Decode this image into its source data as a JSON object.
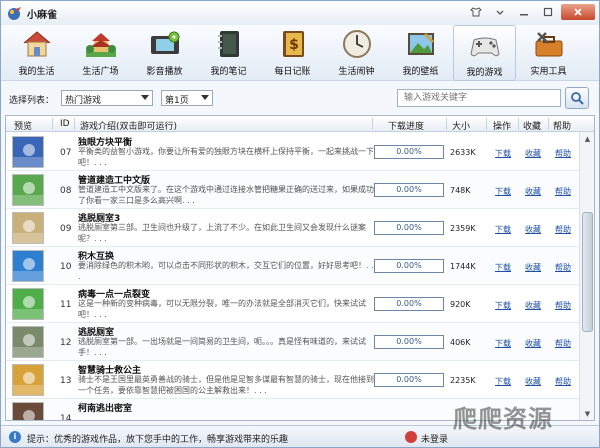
{
  "app": {
    "title": "小麻雀"
  },
  "toolbar": {
    "items": [
      {
        "label": "我的生活",
        "icon": "house-icon"
      },
      {
        "label": "生活广场",
        "icon": "pagoda-icon"
      },
      {
        "label": "影音播放",
        "icon": "film-icon"
      },
      {
        "label": "我的笔记",
        "icon": "notebook-icon"
      },
      {
        "label": "每日记账",
        "icon": "ledger-icon"
      },
      {
        "label": "生活闹钟",
        "icon": "clock-icon"
      },
      {
        "label": "我的壁纸",
        "icon": "wallpaper-icon"
      },
      {
        "label": "我的游戏",
        "icon": "gamepad-icon",
        "active": true
      },
      {
        "label": "实用工具",
        "icon": "toolbox-icon"
      }
    ]
  },
  "filter": {
    "label": "选择列表：",
    "list_value": "热门游戏",
    "page_value": "第1页",
    "search_placeholder": "输入游戏关键字"
  },
  "table": {
    "headers": {
      "preview": "预览",
      "id": "ID",
      "intro": "游戏介绍(双击即可运行)",
      "progress": "下载进度",
      "size": "大小",
      "action": "操作",
      "favorite": "收藏",
      "help": "帮助"
    },
    "rows": [
      {
        "id": "07",
        "name": "独眼方块平衡",
        "desc": "平衡类的益智小游戏，你要让所有爱的独眼方块在横杆上保持平衡，一起来挑战一下吧！. . .",
        "progress": "0.00%",
        "progress_value": 0,
        "size": "2633K",
        "download": "下载",
        "favorite": "收藏",
        "help": "帮助",
        "thumb_color": "#3a66b8"
      },
      {
        "id": "08",
        "name": "管道建造工中文版",
        "desc": "管道建造工中文版来了。在这个游戏中通过连接水管把糖果正确的送过来，如果成功了你看一家三口是多么高兴啊. . .",
        "progress": "0.00%",
        "progress_value": 0,
        "size": "748K",
        "download": "下载",
        "favorite": "收藏",
        "help": "帮助",
        "thumb_color": "#5aa84e"
      },
      {
        "id": "09",
        "name": "逃脱厕室3",
        "desc": "逃脱厕室第三部。卫生间也升级了，上流了不少。在如此卫生间又会发现什么谜案呢？. . .",
        "progress": "0.00%",
        "progress_value": 0,
        "size": "2359K",
        "download": "下载",
        "favorite": "收藏",
        "help": "帮助",
        "thumb_color": "#c9b07a"
      },
      {
        "id": "10",
        "name": "积木互换",
        "desc": "要消除绿色的积木哟，可以点击不同形状的积木，交互它们的位置，好好思考吧！. . .",
        "progress": "0.00%",
        "progress_value": 0,
        "size": "1744K",
        "download": "下载",
        "favorite": "收藏",
        "help": "帮助",
        "thumb_color": "#2f7fd0"
      },
      {
        "id": "11",
        "name": "病毒一点一点裂变",
        "desc": "这是一种新的变种病毒，可以无限分裂，唯一的办法就是全部消灭它们，快来试试吧！. . .",
        "progress": "0.00%",
        "progress_value": 0,
        "size": "920K",
        "download": "下载",
        "favorite": "收藏",
        "help": "帮助",
        "thumb_color": "#4fae4a"
      },
      {
        "id": "12",
        "name": "逃脱厕室",
        "desc": "逃脱厕室第一部。一出场就是一间简易的卫生间，呃。。。真是怪有味道的，来试试手！. . .",
        "progress": "0.00%",
        "progress_value": 0,
        "size": "406K",
        "download": "下载",
        "favorite": "收藏",
        "help": "帮助",
        "thumb_color": "#7a8a6a"
      },
      {
        "id": "13",
        "name": "智慧骑士救公主",
        "desc": "骑士不是王国里最英勇善战的骑士，但是他是足智多谋最有智慧的骑士，现在他接到一个任务，要依靠智慧把被困国的公主解救出来！. . .",
        "progress": "0.00%",
        "progress_value": 0,
        "size": "2235K",
        "download": "下载",
        "favorite": "收藏",
        "help": "帮助",
        "thumb_color": "#d8a23a"
      },
      {
        "id": "14",
        "name": "柯南逃出密室",
        "desc": "",
        "progress": "",
        "progress_value": 0,
        "size": "",
        "download": "",
        "favorite": "",
        "help": "",
        "thumb_color": "#6a4a3a"
      }
    ]
  },
  "status": {
    "tip": "提示：优秀的游戏作品，放下您手中的工作，畅享游戏带来的乐趣",
    "login": "未登录"
  },
  "watermark": "爬爬资源",
  "colors": {
    "accent": "#4a8fd8",
    "link": "#1d4fa8",
    "border": "#8aa6c8"
  }
}
